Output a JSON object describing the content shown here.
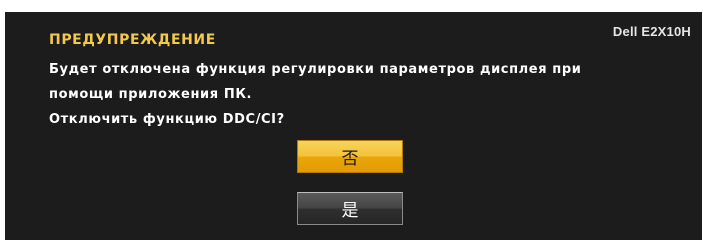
{
  "dialog": {
    "model": "Dell E2X10H",
    "title": "ПРЕДУПРЕЖДЕНИЕ",
    "message_lines": [
      "Будет отключена функция регулировки параметров дисплея при",
      "помощи приложения ПК.",
      "Отключить функцию DDC/CI?"
    ],
    "buttons": {
      "no_label": "否",
      "yes_label": "是"
    }
  },
  "colors": {
    "background": "#1c1c1c",
    "title": "#f2c94a",
    "text": "#ffffff",
    "selected_button": "#f0b42a",
    "unselected_button": "#3a3a3a"
  }
}
